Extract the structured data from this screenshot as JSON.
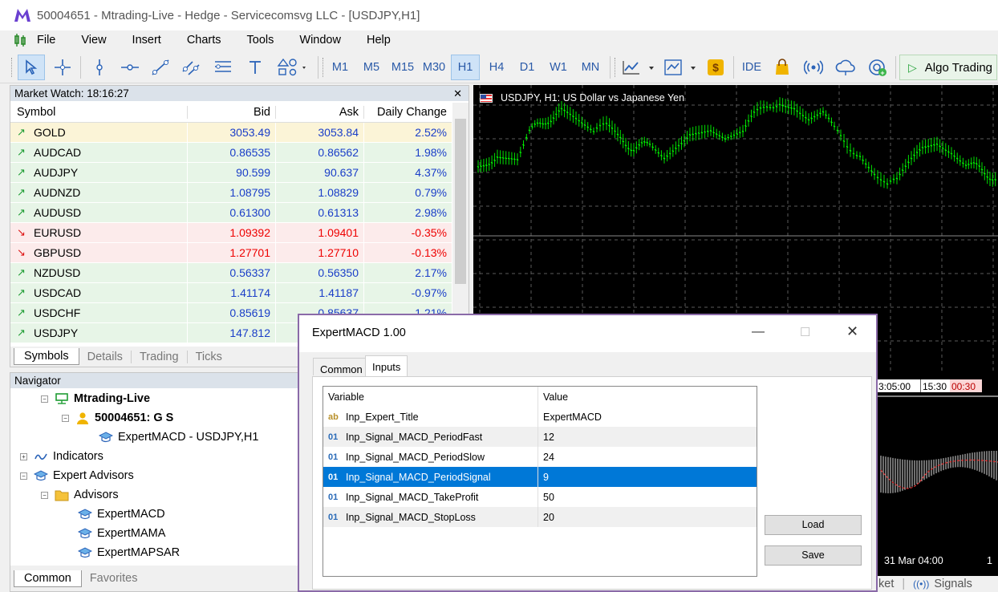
{
  "window": {
    "title": "50004651 - Mtrading-Live - Hedge - Servicecomsvg LLC - [USDJPY,H1]"
  },
  "menu": [
    "File",
    "View",
    "Insert",
    "Charts",
    "Tools",
    "Window",
    "Help"
  ],
  "toolbar": {
    "timeframes": [
      "M1",
      "M5",
      "M15",
      "M30",
      "H1",
      "H4",
      "D1",
      "W1",
      "MN"
    ],
    "selected_timeframe": "H1",
    "ide_label": "IDE",
    "algo_label": "Algo Trading",
    "icons": [
      "cursor-icon",
      "crosshair-icon",
      "vertical-line-icon",
      "horizontal-line-icon",
      "trendline-icon",
      "channel-icon",
      "fibonacci-icon",
      "text-icon",
      "shapes-icon",
      "chart-type-icon",
      "indicators-icon",
      "signals-dollar-icon",
      "market-bag-icon",
      "broadcast-icon",
      "cloud-icon",
      "vps-icon"
    ]
  },
  "market_watch": {
    "title": "Market Watch: 18:16:27",
    "columns": [
      "Symbol",
      "Bid",
      "Ask",
      "Daily Change"
    ],
    "rows": [
      {
        "symbol": "GOLD",
        "bid": "3053.49",
        "ask": "3053.84",
        "change": "2.52%",
        "dir": "up"
      },
      {
        "symbol": "AUDCAD",
        "bid": "0.86535",
        "ask": "0.86562",
        "change": "1.98%",
        "dir": "up"
      },
      {
        "symbol": "AUDJPY",
        "bid": "90.599",
        "ask": "90.637",
        "change": "4.37%",
        "dir": "up"
      },
      {
        "symbol": "AUDNZD",
        "bid": "1.08795",
        "ask": "1.08829",
        "change": "0.79%",
        "dir": "up"
      },
      {
        "symbol": "AUDUSD",
        "bid": "0.61300",
        "ask": "0.61313",
        "change": "2.98%",
        "dir": "up"
      },
      {
        "symbol": "EURUSD",
        "bid": "1.09392",
        "ask": "1.09401",
        "change": "-0.35%",
        "dir": "down"
      },
      {
        "symbol": "GBPUSD",
        "bid": "1.27701",
        "ask": "1.27710",
        "change": "-0.13%",
        "dir": "down"
      },
      {
        "symbol": "NZDUSD",
        "bid": "0.56337",
        "ask": "0.56350",
        "change": "2.17%",
        "dir": "up"
      },
      {
        "symbol": "USDCAD",
        "bid": "1.41174",
        "ask": "1.41187",
        "change": "-0.97%",
        "dir": "up"
      },
      {
        "symbol": "USDCHF",
        "bid": "0.85619",
        "ask": "0.85637",
        "change": "1.21%",
        "dir": "up"
      },
      {
        "symbol": "USDJPY",
        "bid": "147.812",
        "ask": "",
        "change": "",
        "dir": "up"
      }
    ],
    "tabs": [
      "Symbols",
      "Details",
      "Trading",
      "Ticks"
    ]
  },
  "navigator": {
    "title": "Navigator",
    "server": "Mtrading-Live",
    "account": "50004651: G S",
    "attached": "ExpertMACD - USDJPY,H1",
    "indicators": "Indicators",
    "experts": "Expert Advisors",
    "advisors": "Advisors",
    "items": [
      "ExpertMACD",
      "ExpertMAMA",
      "ExpertMAPSAR"
    ],
    "tabs": [
      "Common",
      "Favorites"
    ]
  },
  "chart": {
    "title": "USDJPY, H1:  US Dollar vs Japanese Yen",
    "time_labels": [
      "3:05:00",
      "15:30",
      "00:30"
    ],
    "bottom_time": "31 Mar 04:00",
    "bottom_time2": "1",
    "bottom_tabs": [
      "ket",
      "Signals"
    ]
  },
  "dialog": {
    "title": "ExpertMACD 1.00",
    "tabs": [
      "Common",
      "Inputs"
    ],
    "columns": [
      "Variable",
      "Value"
    ],
    "rows": [
      {
        "type": "ab",
        "variable": "Inp_Expert_Title",
        "value": "ExpertMACD"
      },
      {
        "type": "01",
        "variable": "Inp_Signal_MACD_PeriodFast",
        "value": "12"
      },
      {
        "type": "01",
        "variable": "Inp_Signal_MACD_PeriodSlow",
        "value": "24"
      },
      {
        "type": "01",
        "variable": "Inp_Signal_MACD_PeriodSignal",
        "value": "9"
      },
      {
        "type": "01",
        "variable": "Inp_Signal_MACD_TakeProfit",
        "value": "50"
      },
      {
        "type": "01",
        "variable": "Inp_Signal_MACD_StopLoss",
        "value": "20"
      }
    ],
    "selected_row": 3,
    "load_label": "Load",
    "save_label": "Save"
  },
  "colors": {
    "selection": "#0078d7",
    "candle": "#00ff00",
    "up_price": "#1a3ec8",
    "down_price": "#ee0000",
    "dialog_border": "#8a6aa8"
  }
}
